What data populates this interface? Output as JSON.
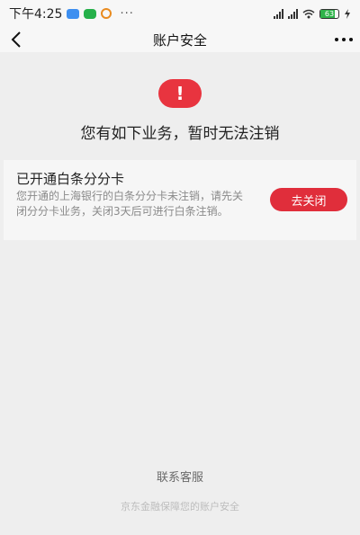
{
  "status_bar": {
    "time": "下午4:25",
    "overflow_dots": "···",
    "battery": "63"
  },
  "nav": {
    "title": "账户安全"
  },
  "alert": {
    "icon_symbol": "!",
    "headline": "您有如下业务，暂时无法注销"
  },
  "card": {
    "title": "已开通白条分分卡",
    "description": "您开通的上海银行的白条分分卡未注销，请先关闭分分卡业务，关闭3天后可进行白条注销。",
    "button_label": "去关闭"
  },
  "footer": {
    "contact_label": "联系客服",
    "note": "京东金融保障您的账户安全"
  },
  "colors": {
    "accent_red": "#e02e3b",
    "background": "#eeeeee"
  }
}
